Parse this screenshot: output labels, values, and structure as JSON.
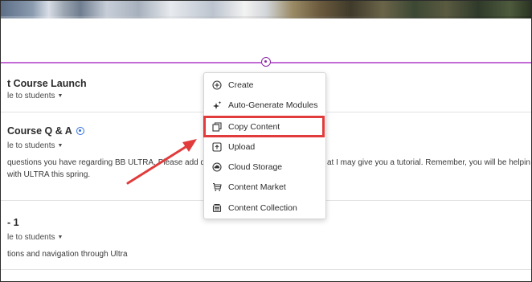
{
  "menu": {
    "items": [
      {
        "label": "Create",
        "icon": "plus-circle-icon"
      },
      {
        "label": "Auto-Generate Modules",
        "icon": "sparkle-icon"
      },
      {
        "label": "Copy Content",
        "icon": "copy-icon"
      },
      {
        "label": "Upload",
        "icon": "upload-icon"
      },
      {
        "label": "Cloud Storage",
        "icon": "cloud-icon"
      },
      {
        "label": "Content Market",
        "icon": "market-icon"
      },
      {
        "label": "Content Collection",
        "icon": "collection-icon"
      }
    ],
    "highlighted": "Copy Content"
  },
  "content": {
    "items": [
      {
        "title": "t Course Launch",
        "visibility": "le to students"
      },
      {
        "title": "Course Q & A",
        "visibility": "le to students",
        "desc_left": "questions you have regarding BB ULTRA. Please add qu",
        "desc_right": "at I may give you a tutorial. Remember, you will be helpin",
        "desc_line2": "with ULTRA this spring."
      },
      {
        "title": "- 1",
        "visibility": "le to students",
        "desc_left": "tions and navigation through Ultra"
      }
    ]
  },
  "colors": {
    "divider": "#c26bd6",
    "highlight": "#e23b3b",
    "arrow": "#e23b3b",
    "ultra_badge": "#2f6fe0"
  }
}
